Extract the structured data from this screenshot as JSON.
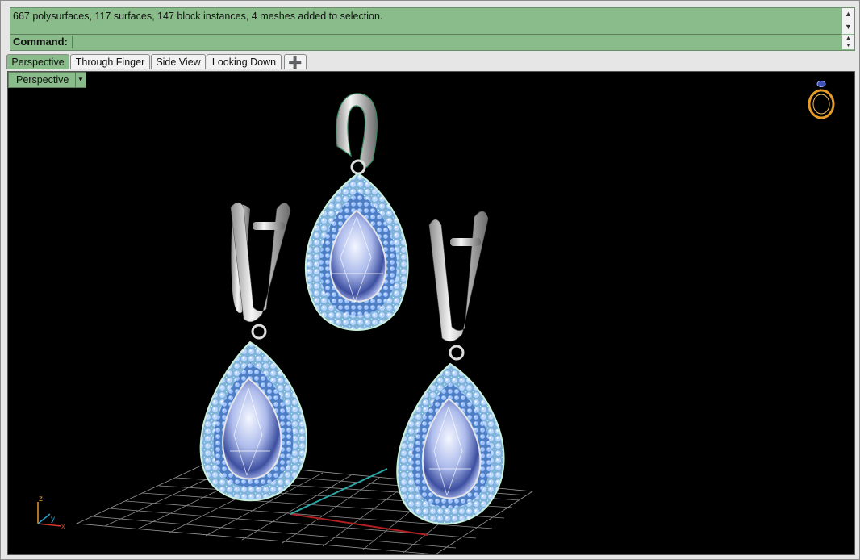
{
  "command_area": {
    "history_text": "667 polysurfaces, 117 surfaces, 147 block instances, 4 meshes added to selection.",
    "prompt_label": "Command:",
    "input_value": ""
  },
  "tabs": [
    {
      "label": "Perspective",
      "active": true
    },
    {
      "label": "Through Finger",
      "active": false
    },
    {
      "label": "Side View",
      "active": false
    },
    {
      "label": "Looking Down",
      "active": false
    }
  ],
  "viewport": {
    "label": "Perspective",
    "axes": {
      "z": "z",
      "y": "y",
      "x": "x"
    }
  },
  "colors": {
    "accent": "#8abb8a",
    "viewport_bg": "#000000",
    "grid": "#8c8c8c",
    "gem_blue": "#9fc3ff",
    "metal": "#d9d9d9",
    "x_axis": "#b02020",
    "y_axis": "#2aa7a7"
  }
}
